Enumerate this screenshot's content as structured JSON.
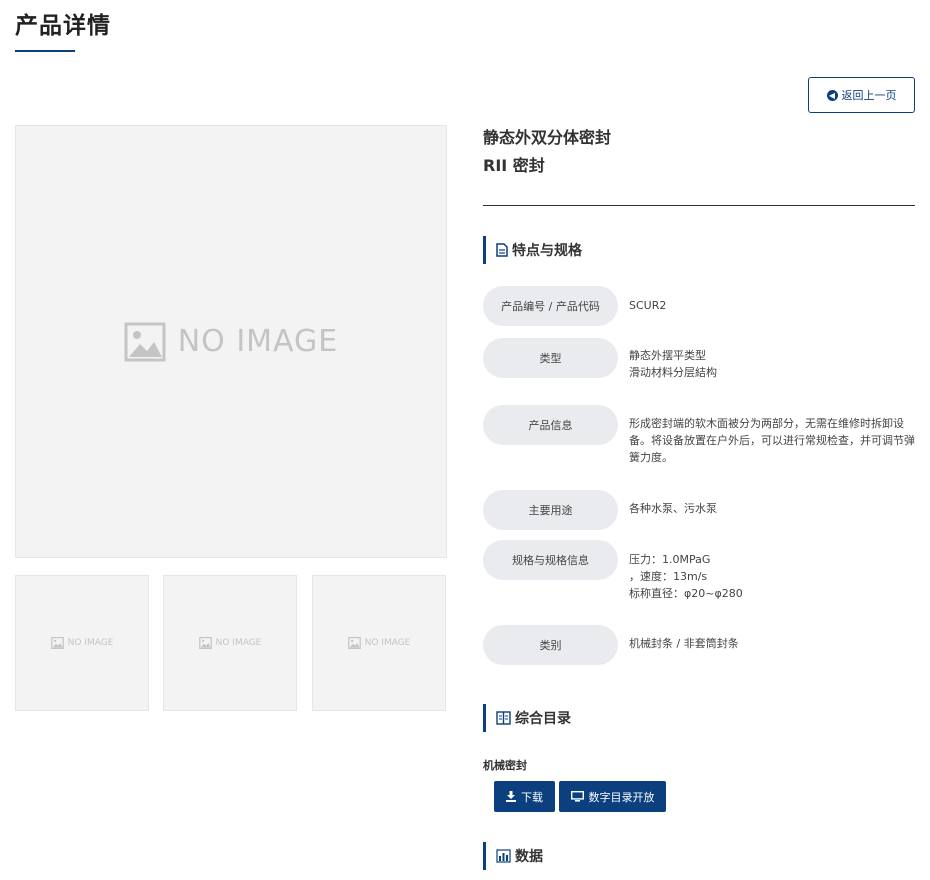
{
  "page": {
    "title": "产品详情"
  },
  "back_button": {
    "label": "返回上一页"
  },
  "images": {
    "main_placeholder": "NO IMAGE",
    "thumb_placeholder": "NO IMAGE"
  },
  "product": {
    "name_line1": "静态外双分体密封",
    "name_line2": "RII 密封"
  },
  "features": {
    "heading": "特点与规格",
    "rows": [
      {
        "label": "产品编号 / 产品代码",
        "value": "SCUR2"
      },
      {
        "label": "类型",
        "value": "静态外摆平类型\n滑动材料分层結构"
      },
      {
        "label": "产品信息",
        "value": "形成密封端的软木面被分为两部分，无需在维修时拆卸设备。将设备放置在户外后，可以进行常规检查，并可调节弹簧力度。"
      },
      {
        "label": "主要用途",
        "value": "各种水泵、污水泵"
      },
      {
        "label": "规格与规格信息",
        "value": "压力：1.0MPaG\n，速度：13m/s\n标称直径：φ20~φ280"
      },
      {
        "label": "类别",
        "value": "机械封条 / 非套筒封条"
      }
    ]
  },
  "catalog": {
    "heading": "综合目录",
    "subtitle": "机械密封",
    "download_label": "下载",
    "digital_label": "数字目录开放"
  },
  "data_section": {
    "heading": "数据"
  },
  "colors": {
    "accent": "#0b3f7e",
    "label_bg": "#e9ebee",
    "placeholder_bg": "#f3f3f3"
  }
}
